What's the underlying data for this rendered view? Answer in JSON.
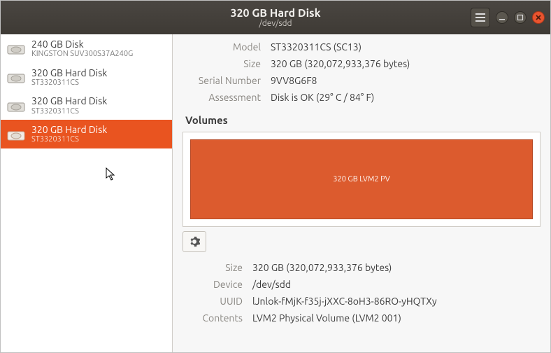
{
  "header": {
    "title": "320 GB Hard Disk",
    "subtitle": "/dev/sdd"
  },
  "sidebar": {
    "items": [
      {
        "name": "240 GB Disk",
        "model": "KINGSTON SUV300S37A240G"
      },
      {
        "name": "320 GB Hard Disk",
        "model": "ST3320311CS"
      },
      {
        "name": "320 GB Hard Disk",
        "model": "ST3320311CS"
      },
      {
        "name": "320 GB Hard Disk",
        "model": "ST3320311CS"
      }
    ]
  },
  "info": {
    "model_label": "Model",
    "model_value": "ST3320311CS (SC13)",
    "size_label": "Size",
    "size_value": "320 GB (320,072,933,376 bytes)",
    "serial_label": "Serial Number",
    "serial_value": "9VV8G6F8",
    "assess_label": "Assessment",
    "assess_value": "Disk is OK (29° C / 84° F)"
  },
  "volumes": {
    "heading": "Volumes",
    "partition_label": "320 GB LVM2 PV"
  },
  "volinfo": {
    "size_label": "Size",
    "size_value": "320 GB (320,072,933,376 bytes)",
    "device_label": "Device",
    "device_value": "/dev/sdd",
    "uuid_label": "UUID",
    "uuid_value": "lJnlok-fMjK-f35j-jXXC-8oH3-86RO-yHQTXy",
    "contents_label": "Contents",
    "contents_value": "LVM2 Physical Volume (LVM2 001)"
  }
}
